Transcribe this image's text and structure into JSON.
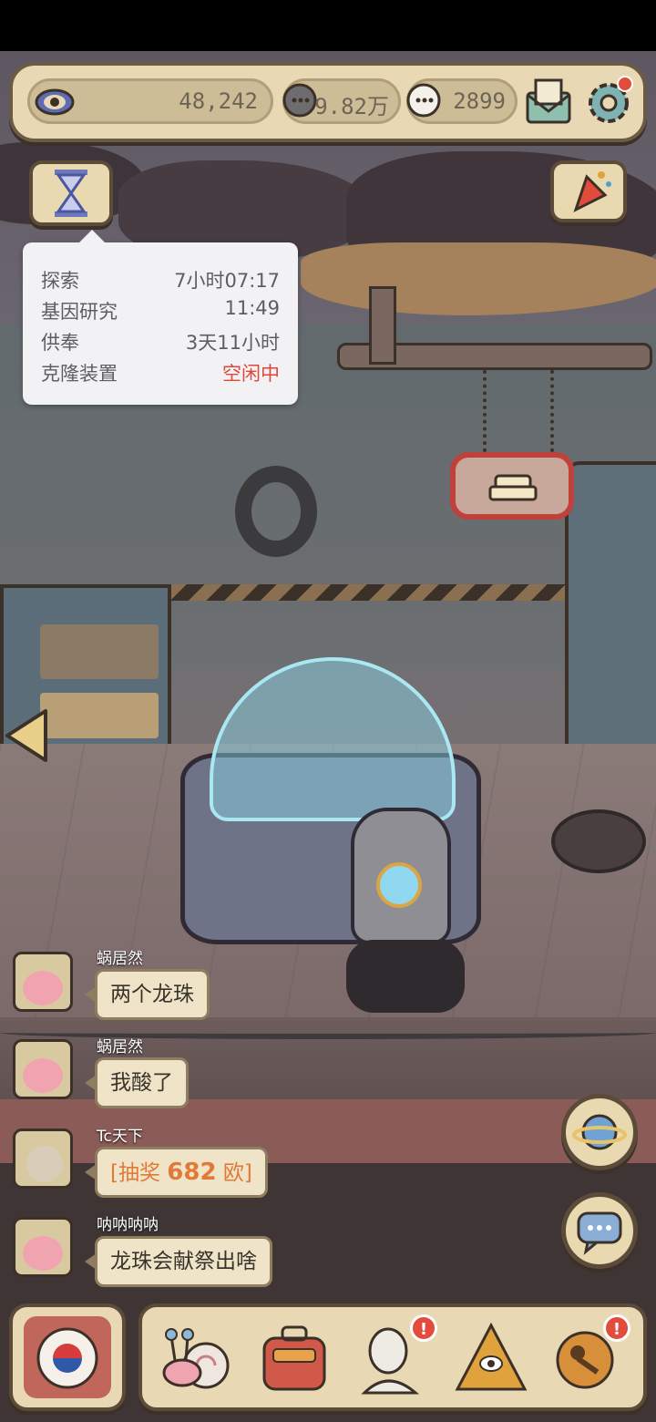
{
  "resources": {
    "eye_value": "48,242",
    "gray_coin_value": "9.82万",
    "white_coin_value": "2899"
  },
  "status_panel": {
    "rows": [
      {
        "label": "探索",
        "value": "7小时07:17",
        "value_color": "#5d5d63"
      },
      {
        "label": "基因研究",
        "value": "11:49",
        "value_color": "#5d5d63"
      },
      {
        "label": "供奉",
        "value": "3天11小时",
        "value_color": "#5d5d63"
      },
      {
        "label": "克隆装置",
        "value": "空闲中",
        "value_color": "#e0463a"
      }
    ]
  },
  "chat": [
    {
      "user": "蜗居然",
      "message": "两个龙珠"
    },
    {
      "user": "蜗居然",
      "message": "我酸了"
    },
    {
      "user": "Tc天下",
      "message_prefix": "[抽奖",
      "message_number": "682",
      "message_suffix": "欧]"
    },
    {
      "user": "呐呐呐呐",
      "message": "龙珠会献祭出啥"
    }
  ],
  "colors": {
    "panel": "#e8d9b4",
    "border": "#5d4b3a",
    "badge": "#e34b3c",
    "idle_text": "#e0463a",
    "lottery_text": "#e07a38"
  },
  "icons": [
    "eye-icon",
    "gray-coin-icon",
    "white-coin-icon",
    "mail-icon",
    "settings-icon",
    "hourglass-icon",
    "party-popper-icon",
    "bed-sign-icon",
    "left-arrow-icon",
    "planet-icon",
    "chat-icon",
    "korea-flag-icon",
    "snail-icon",
    "backpack-icon",
    "bust-icon",
    "pyramid-icon",
    "key-icon"
  ]
}
